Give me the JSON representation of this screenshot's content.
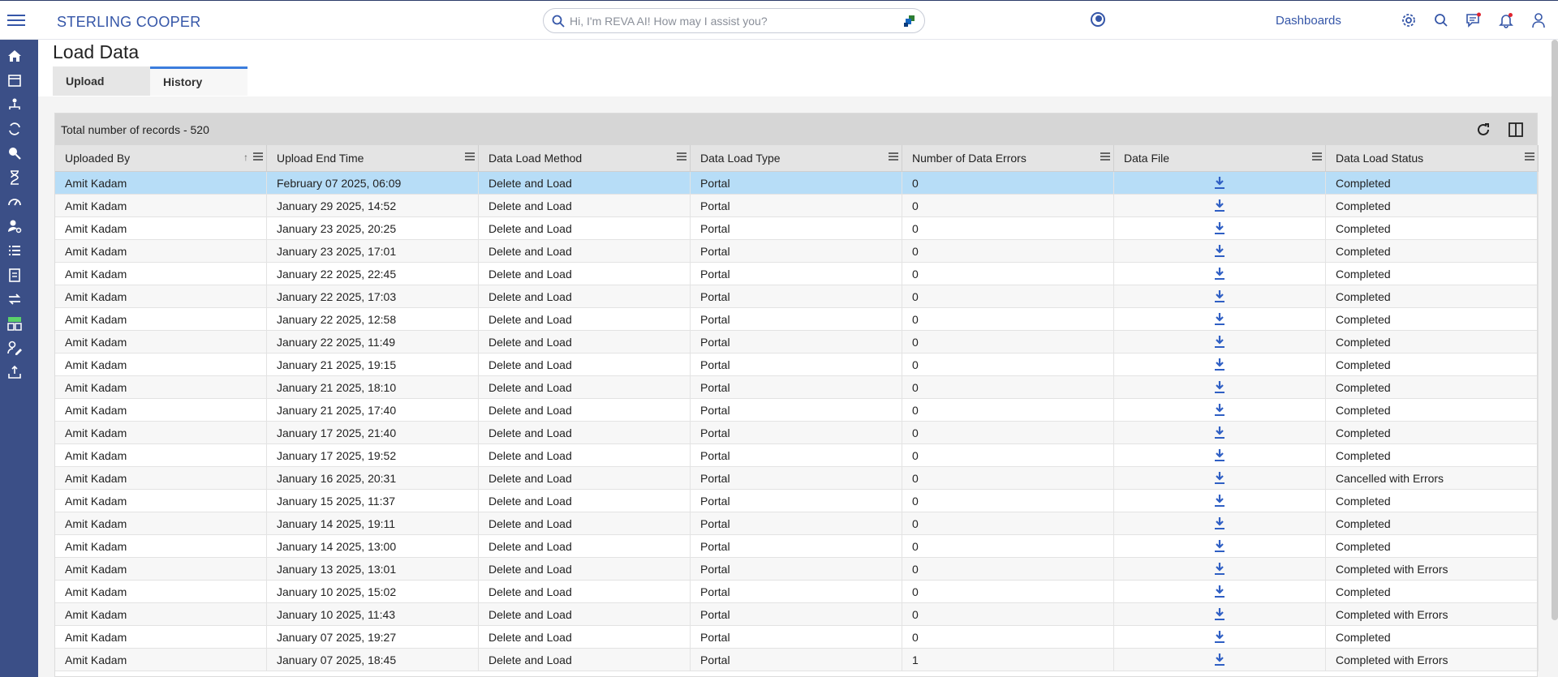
{
  "app": {
    "brand": "STERLING COOPER",
    "search_placeholder": "Hi, I'm REVA AI! How may I assist you?",
    "dashboards_label": "Dashboards"
  },
  "page": {
    "title": "Load Data",
    "tabs": [
      {
        "label": "Upload",
        "active": false
      },
      {
        "label": "History",
        "active": true
      }
    ]
  },
  "grid": {
    "record_count_text": "Total number of records - 520",
    "columns": [
      "Uploaded By",
      "Upload End Time",
      "Data Load Method",
      "Data Load Type",
      "Number of Data Errors",
      "Data File",
      "Data Load Status"
    ],
    "sorted_column": "Uploaded By",
    "sort_direction": "ascending",
    "rows": [
      {
        "uploaded_by": "Amit Kadam",
        "end_time": "February 07 2025, 06:09",
        "method": "Delete and Load",
        "type": "Portal",
        "errors": "0",
        "status": "Completed"
      },
      {
        "uploaded_by": "Amit Kadam",
        "end_time": "January 29 2025, 14:52",
        "method": "Delete and Load",
        "type": "Portal",
        "errors": "0",
        "status": "Completed"
      },
      {
        "uploaded_by": "Amit Kadam",
        "end_time": "January 23 2025, 20:25",
        "method": "Delete and Load",
        "type": "Portal",
        "errors": "0",
        "status": "Completed"
      },
      {
        "uploaded_by": "Amit Kadam",
        "end_time": "January 23 2025, 17:01",
        "method": "Delete and Load",
        "type": "Portal",
        "errors": "0",
        "status": "Completed"
      },
      {
        "uploaded_by": "Amit Kadam",
        "end_time": "January 22 2025, 22:45",
        "method": "Delete and Load",
        "type": "Portal",
        "errors": "0",
        "status": "Completed"
      },
      {
        "uploaded_by": "Amit Kadam",
        "end_time": "January 22 2025, 17:03",
        "method": "Delete and Load",
        "type": "Portal",
        "errors": "0",
        "status": "Completed"
      },
      {
        "uploaded_by": "Amit Kadam",
        "end_time": "January 22 2025, 12:58",
        "method": "Delete and Load",
        "type": "Portal",
        "errors": "0",
        "status": "Completed"
      },
      {
        "uploaded_by": "Amit Kadam",
        "end_time": "January 22 2025, 11:49",
        "method": "Delete and Load",
        "type": "Portal",
        "errors": "0",
        "status": "Completed"
      },
      {
        "uploaded_by": "Amit Kadam",
        "end_time": "January 21 2025, 19:15",
        "method": "Delete and Load",
        "type": "Portal",
        "errors": "0",
        "status": "Completed"
      },
      {
        "uploaded_by": "Amit Kadam",
        "end_time": "January 21 2025, 18:10",
        "method": "Delete and Load",
        "type": "Portal",
        "errors": "0",
        "status": "Completed"
      },
      {
        "uploaded_by": "Amit Kadam",
        "end_time": "January 21 2025, 17:40",
        "method": "Delete and Load",
        "type": "Portal",
        "errors": "0",
        "status": "Completed"
      },
      {
        "uploaded_by": "Amit Kadam",
        "end_time": "January 17 2025, 21:40",
        "method": "Delete and Load",
        "type": "Portal",
        "errors": "0",
        "status": "Completed"
      },
      {
        "uploaded_by": "Amit Kadam",
        "end_time": "January 17 2025, 19:52",
        "method": "Delete and Load",
        "type": "Portal",
        "errors": "0",
        "status": "Completed"
      },
      {
        "uploaded_by": "Amit Kadam",
        "end_time": "January 16 2025, 20:31",
        "method": "Delete and Load",
        "type": "Portal",
        "errors": "0",
        "status": "Cancelled with Errors"
      },
      {
        "uploaded_by": "Amit Kadam",
        "end_time": "January 15 2025, 11:37",
        "method": "Delete and Load",
        "type": "Portal",
        "errors": "0",
        "status": "Completed"
      },
      {
        "uploaded_by": "Amit Kadam",
        "end_time": "January 14 2025, 19:11",
        "method": "Delete and Load",
        "type": "Portal",
        "errors": "0",
        "status": "Completed"
      },
      {
        "uploaded_by": "Amit Kadam",
        "end_time": "January 14 2025, 13:00",
        "method": "Delete and Load",
        "type": "Portal",
        "errors": "0",
        "status": "Completed"
      },
      {
        "uploaded_by": "Amit Kadam",
        "end_time": "January 13 2025, 13:01",
        "method": "Delete and Load",
        "type": "Portal",
        "errors": "0",
        "status": "Completed with Errors"
      },
      {
        "uploaded_by": "Amit Kadam",
        "end_time": "January 10 2025, 15:02",
        "method": "Delete and Load",
        "type": "Portal",
        "errors": "0",
        "status": "Completed"
      },
      {
        "uploaded_by": "Amit Kadam",
        "end_time": "January 10 2025, 11:43",
        "method": "Delete and Load",
        "type": "Portal",
        "errors": "0",
        "status": "Completed with Errors"
      },
      {
        "uploaded_by": "Amit Kadam",
        "end_time": "January 07 2025, 19:27",
        "method": "Delete and Load",
        "type": "Portal",
        "errors": "0",
        "status": "Completed"
      },
      {
        "uploaded_by": "Amit Kadam",
        "end_time": "January 07 2025, 18:45",
        "method": "Delete and Load",
        "type": "Portal",
        "errors": "1",
        "status": "Completed with Errors"
      }
    ]
  },
  "icons": {
    "sidebar": [
      "home-icon",
      "calendar-icon",
      "org-chart-icon",
      "sync-icon",
      "search-people-icon",
      "hourglass-icon",
      "speedometer-icon",
      "user-settings-icon",
      "list-icon",
      "clipboard-icon",
      "transfer-icon",
      "new-grid-icon",
      "user-edit-icon",
      "upload-tray-icon"
    ],
    "topbar": [
      "gear-icon",
      "search-icon",
      "chat-icon",
      "bell-icon",
      "user-icon"
    ]
  },
  "colors": {
    "brand": "#3556a8",
    "sidebar": "#3b4f87",
    "selected_row": "#b7ddf7",
    "active_tab_border": "#3b7ddd",
    "download_icon": "#2f5fc4",
    "notification_dot": "#e0242f"
  }
}
